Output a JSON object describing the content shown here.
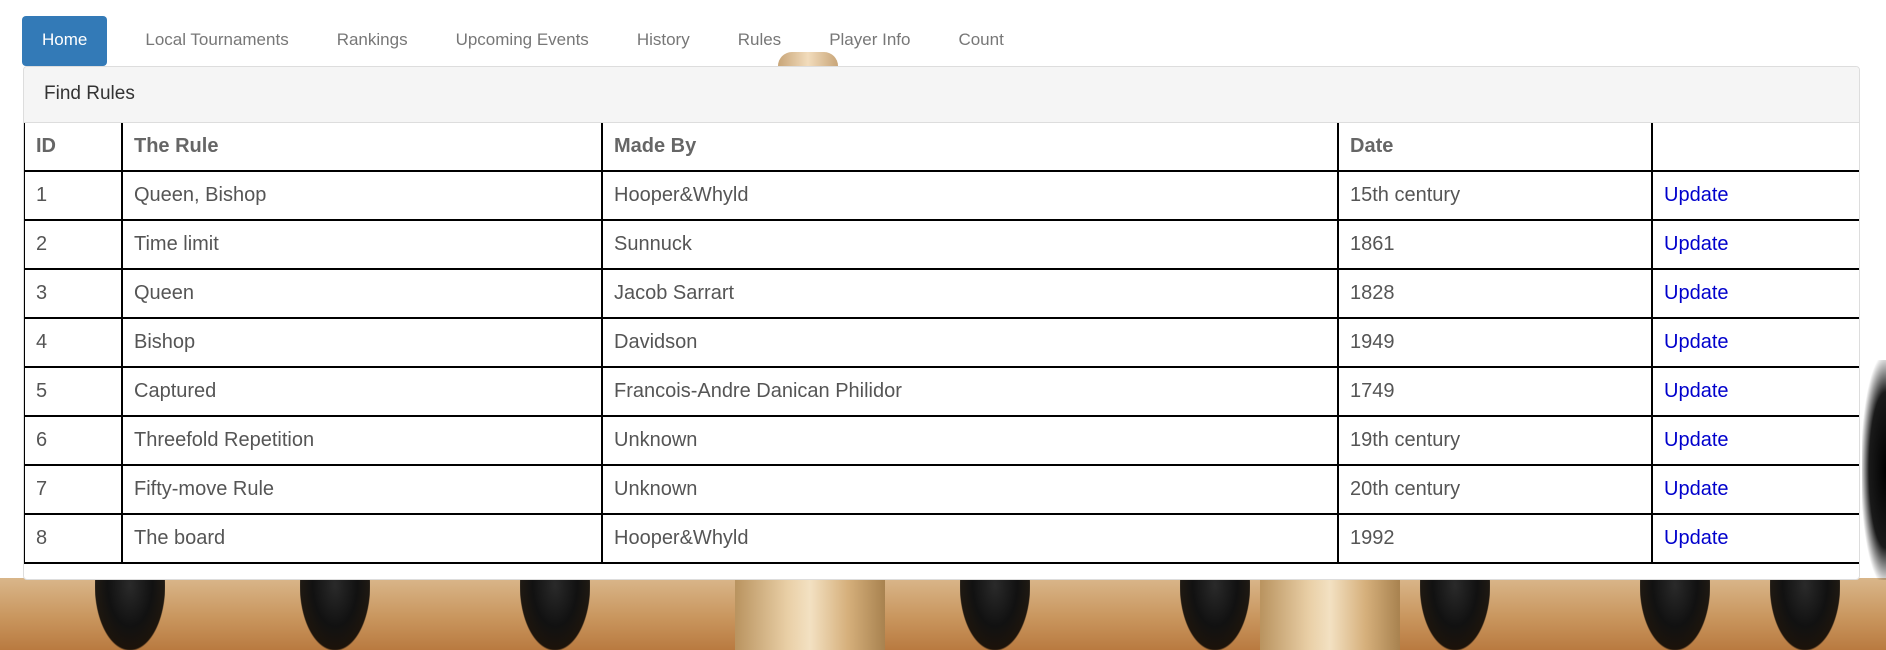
{
  "nav": {
    "items": [
      {
        "label": "Home",
        "active": true
      },
      {
        "label": "Local Tournaments"
      },
      {
        "label": "Rankings"
      },
      {
        "label": "Upcoming Events"
      },
      {
        "label": "History"
      },
      {
        "label": "Rules"
      },
      {
        "label": "Player Info"
      },
      {
        "label": "Count"
      }
    ]
  },
  "panel": {
    "heading": "Find Rules"
  },
  "table": {
    "headers": [
      "ID",
      "The Rule",
      "Made By",
      "Date",
      ""
    ],
    "rows": [
      {
        "id": "1",
        "rule": "Queen, Bishop",
        "made_by": "Hooper&Whyld",
        "date": "15th century",
        "action": "Update"
      },
      {
        "id": "2",
        "rule": "Time limit",
        "made_by": "Sunnuck",
        "date": "1861",
        "action": "Update"
      },
      {
        "id": "3",
        "rule": "Queen",
        "made_by": "Jacob Sarrart",
        "date": "1828",
        "action": "Update"
      },
      {
        "id": "4",
        "rule": "Bishop",
        "made_by": "Davidson",
        "date": "1949",
        "action": "Update"
      },
      {
        "id": "5",
        "rule": "Captured",
        "made_by": "Francois-Andre Danican Philidor",
        "date": "1749",
        "action": "Update"
      },
      {
        "id": "6",
        "rule": "Threefold Repetition",
        "made_by": "Unknown",
        "date": "19th century",
        "action": "Update"
      },
      {
        "id": "7",
        "rule": "Fifty-move Rule",
        "made_by": "Unknown",
        "date": "20th century",
        "action": "Update"
      },
      {
        "id": "8",
        "rule": "The board",
        "made_by": "Hooper&Whyld",
        "date": "1992",
        "action": "Update"
      }
    ]
  },
  "colors": {
    "accent": "#337ab7",
    "link": "#0000cc"
  }
}
